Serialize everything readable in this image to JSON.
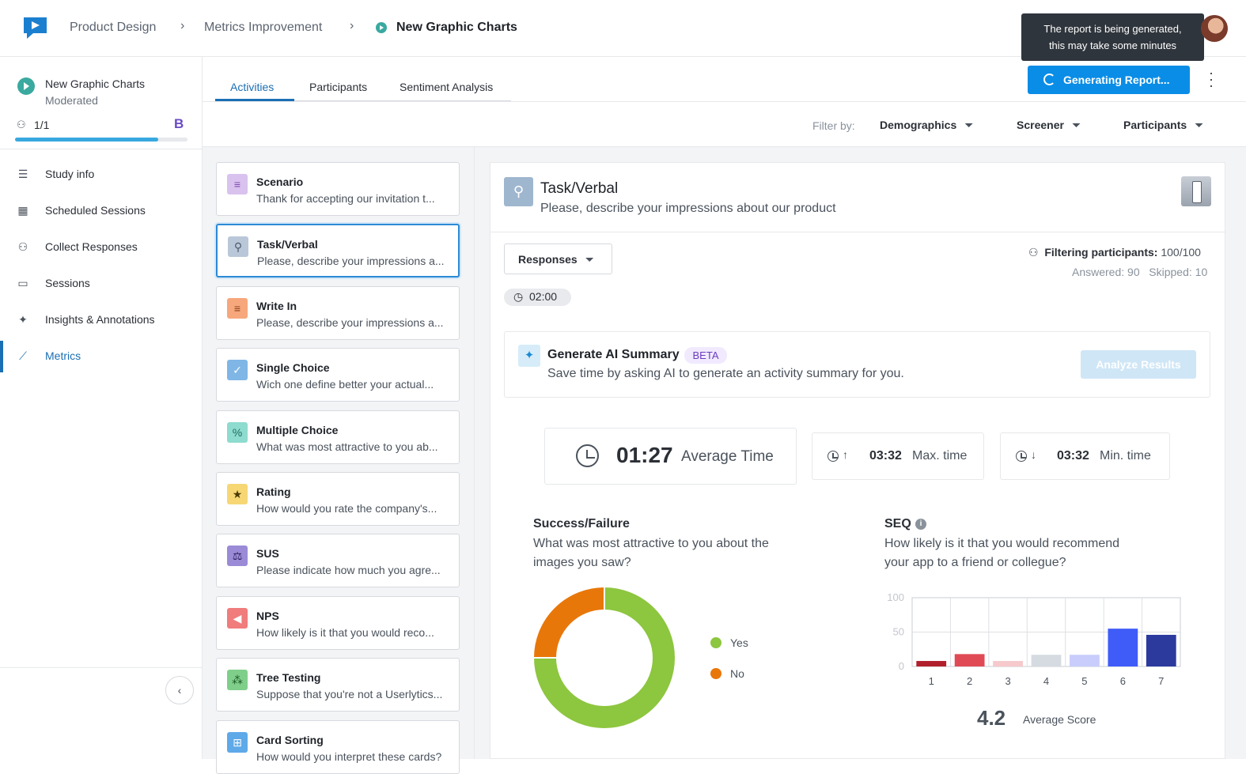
{
  "breadcrumb": [
    "Product Design",
    "Metrics Improvement",
    "New Graphic Charts"
  ],
  "tooltip": {
    "line1": "The report is being generated,",
    "line2": "this may take some minutes"
  },
  "study": {
    "title": "New Graphic Charts",
    "subtitle": "Moderated",
    "count": "1/1",
    "badge": "B",
    "progress": 0.83
  },
  "nav": [
    {
      "label": "Study info",
      "icon": "list-icon"
    },
    {
      "label": "Scheduled Sessions",
      "icon": "calendar-icon"
    },
    {
      "label": "Collect Responses",
      "icon": "people-icon"
    },
    {
      "label": "Sessions",
      "icon": "video-icon"
    },
    {
      "label": "Insights & Annotations",
      "icon": "sparkles-icon"
    },
    {
      "label": "Metrics",
      "icon": "chart-line-icon",
      "active": true
    }
  ],
  "tabs": [
    "Activities",
    "Participants",
    "Sentiment Analysis"
  ],
  "generate_button": "Generating Report...",
  "filter": {
    "label": "Filter by:",
    "items": [
      "Demographics",
      "Screener",
      "Participants"
    ]
  },
  "activities": [
    {
      "title": "Scenario",
      "desc": "Thank for accepting our invitation t...",
      "icon_color": "#d9c2ee",
      "glyph": "≡",
      "glyph_color": "#7d4cb3"
    },
    {
      "title": "Task/Verbal",
      "desc": "Please, describe your impressions a...",
      "icon_color": "#b9c7d8",
      "glyph": "⚲",
      "glyph_color": "#4a5a6d",
      "selected": true
    },
    {
      "title": "Write In",
      "desc": "Please, describe your impressions a...",
      "icon_color": "#f7a77c",
      "glyph": "≡",
      "glyph_color": "#8a3d16"
    },
    {
      "title": "Single Choice",
      "desc": "Wich one define better your actual...",
      "icon_color": "#7fb6e6",
      "glyph": "✓",
      "glyph_color": "#ffffff"
    },
    {
      "title": "Multiple Choice",
      "desc": "What was most attractive to you ab...",
      "icon_color": "#8edbcf",
      "glyph": "%",
      "glyph_color": "#1e6b61"
    },
    {
      "title": "Rating",
      "desc": "How would you rate the company's...",
      "icon_color": "#f6d774",
      "glyph": "★",
      "glyph_color": "#4a3a00"
    },
    {
      "title": "SUS",
      "desc": "Please indicate how much you agre...",
      "icon_color": "#9b8ad6",
      "glyph": "⚖",
      "glyph_color": "#2b1f5e"
    },
    {
      "title": "NPS",
      "desc": "How likely is it that you would reco...",
      "icon_color": "#f07c7c",
      "glyph": "◀",
      "glyph_color": "#ffffff"
    },
    {
      "title": "Tree Testing",
      "desc": "Suppose that you're not a Userlytics...",
      "icon_color": "#7fcf8a",
      "glyph": "⁂",
      "glyph_color": "#1d5a27"
    },
    {
      "title": "Card Sorting",
      "desc": "How would you interpret these cards?",
      "icon_color": "#5ea9e8",
      "glyph": "⊞",
      "glyph_color": "#ffffff"
    }
  ],
  "panel": {
    "title": "Task/Verbal",
    "subtitle": "Please, describe your impressions about our product",
    "responses_label": "Responses",
    "filtering_label": "Filtering participants:",
    "filtering_value": "100/100",
    "answered": "Answered: 90",
    "skipped": "Skipped: 10",
    "time": "02:00"
  },
  "ai": {
    "title": "Generate AI Summary",
    "beta": "BETA",
    "subtitle": "Save time by asking AI to generate an activity summary for you.",
    "button": "Analyze Results"
  },
  "stats": {
    "avg_value": "01:27",
    "avg_label": "Average Time",
    "max_value": "03:32",
    "max_label": "Max. time",
    "min_value": "03:32",
    "min_label": "Min. time"
  },
  "success": {
    "title": "Success/Failure",
    "question_line1": "What was most attractive to you about the",
    "question_line2": "images you saw?"
  },
  "seq": {
    "title": "SEQ",
    "question_line1": "How likely is it that you would recommend",
    "question_line2": "your app to a friend or collegue?",
    "avg_score": "4.2",
    "avg_label": "Average Score"
  },
  "chart_data": [
    {
      "type": "pie",
      "donut": true,
      "categories": [
        "Yes",
        "No"
      ],
      "values": [
        75,
        25
      ],
      "colors": [
        "#8dc63f",
        "#e8770a"
      ]
    },
    {
      "type": "bar",
      "categories": [
        "1",
        "2",
        "3",
        "4",
        "5",
        "6",
        "7"
      ],
      "values": [
        8,
        18,
        8,
        17,
        17,
        55,
        46
      ],
      "ylim": [
        0,
        100
      ],
      "yticks": [
        "0",
        "50",
        "100"
      ],
      "grid": true,
      "colors": [
        "#b0202c",
        "#e04a55",
        "#f6c9cc",
        "#d5dbe0",
        "#c8cdfb",
        "#3f5cf8",
        "#2c3a9e"
      ]
    }
  ]
}
